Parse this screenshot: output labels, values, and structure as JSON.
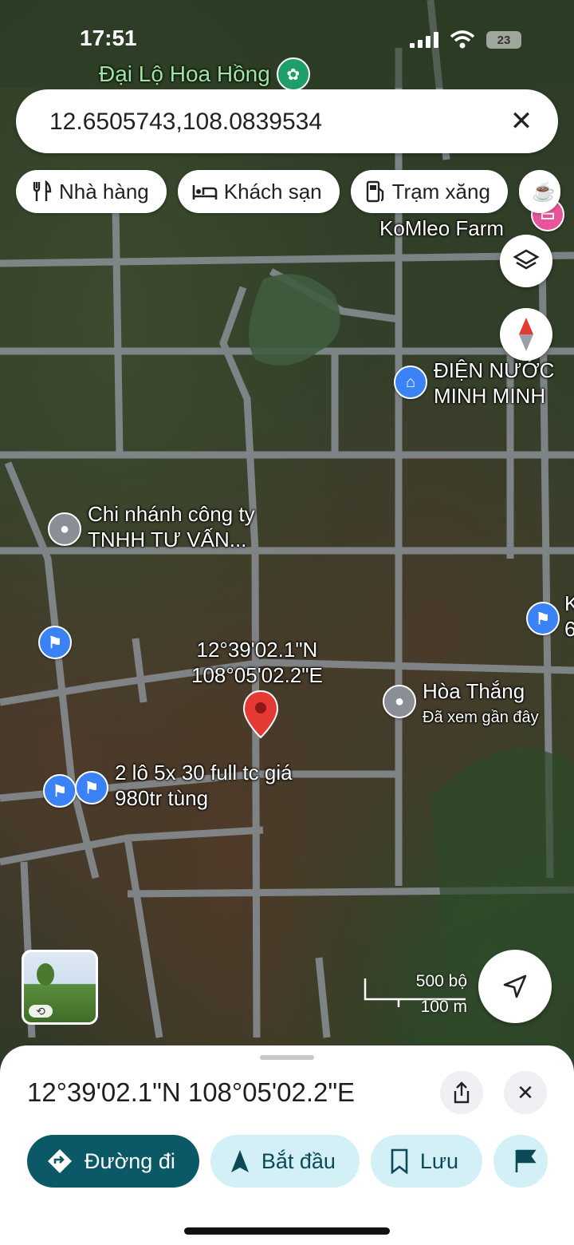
{
  "status": {
    "time": "17:51",
    "battery": "23"
  },
  "map": {
    "top_label": "Đại Lộ Hoa Hồng",
    "labels": {
      "komleo": "KoMleo Farm",
      "dien_nuoc_1": "ĐIỆN NƯỚC",
      "dien_nuoc_2": "MINH MINH",
      "chi_nhanh_1": "Chi nhánh công ty",
      "chi_nhanh_2": "TNHH TƯ VẤN...",
      "coord_1": "12°39'02.1\"N",
      "coord_2": "108°05'02.2\"E",
      "hoa_thang": "Hòa Thắng",
      "hoa_thang_sub": "Đã xem gần đây",
      "lot_1": "2 lô 5x 30 full tc giá",
      "lot_2": "980tr tùng",
      "edge_k": "K",
      "edge_6": "6"
    },
    "scale": {
      "imperial": "500 bộ",
      "metric": "100 m"
    }
  },
  "search": {
    "value": "12.6505743,108.0839534"
  },
  "chips": [
    {
      "label": "Nhà hàng",
      "icon": "fork-knife-icon"
    },
    {
      "label": "Khách sạn",
      "icon": "bed-icon"
    },
    {
      "label": "Trạm xăng",
      "icon": "fuel-icon"
    }
  ],
  "sheet": {
    "title": "12°39'02.1\"N 108°05'02.2\"E",
    "actions": {
      "directions": "Đường đi",
      "start": "Bắt đầu",
      "save": "Lưu"
    }
  },
  "colors": {
    "primary": "#0b5966",
    "secondary": "#d3f0f7",
    "pin": "#e53935",
    "poi_blue": "#3b82f6"
  }
}
